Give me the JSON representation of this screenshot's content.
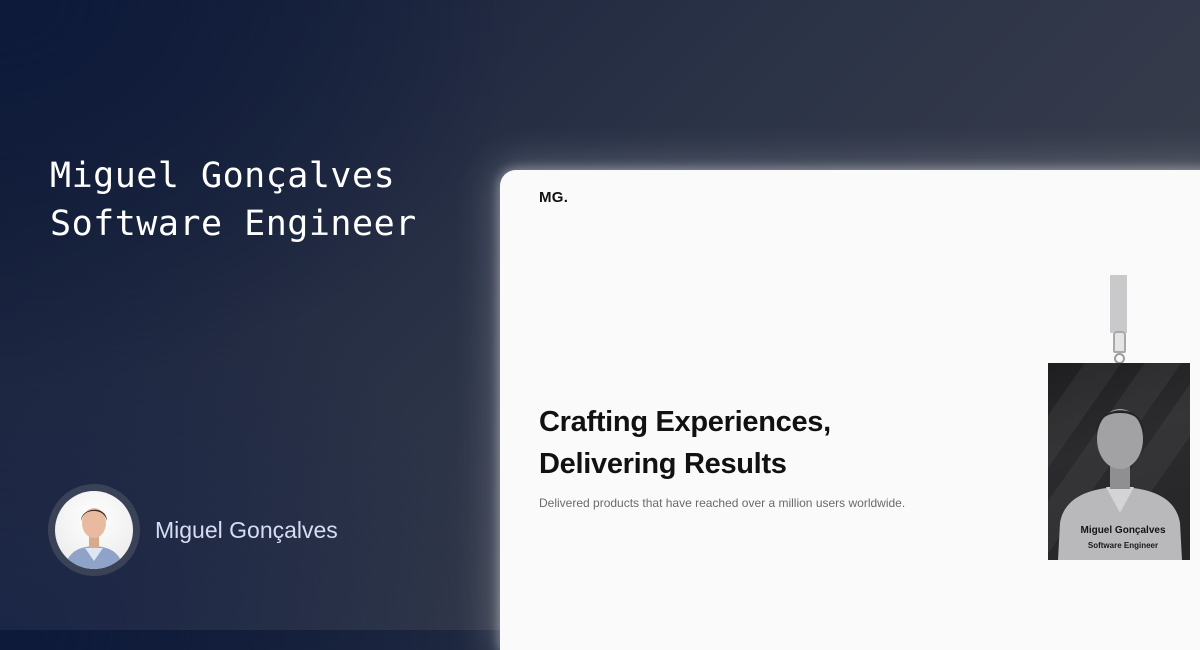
{
  "headline": {
    "line1": "Miguel Gonçalves",
    "line2": "Software Engineer"
  },
  "author": {
    "name": "Miguel Gonçalves",
    "avatar_icon": "person-photo-icon"
  },
  "preview": {
    "logo": "MG.",
    "hero_title_line1": "Crafting Experiences,",
    "hero_title_line2": "Delivering Results",
    "hero_subtitle": "Delivered products that have reached over a million users worldwide.",
    "badge": {
      "name": "Miguel Gonçalves",
      "role": "Software Engineer"
    }
  },
  "colors": {
    "background_dark": "#121c38",
    "background_light": "#3d414f",
    "headline_text": "#ffffff",
    "author_text": "#d6ddf3",
    "preview_bg": "#fafafb",
    "preview_text": "#111111"
  }
}
